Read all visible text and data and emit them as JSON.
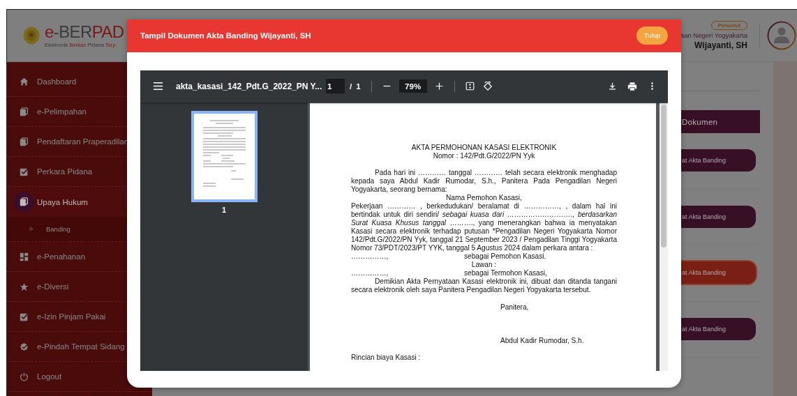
{
  "header": {
    "logo": {
      "title": [
        {
          "text": "e",
          "accent": true
        },
        {
          "text": "-BER",
          "accent": false
        },
        {
          "text": "PAD",
          "accent": true
        }
      ],
      "subtitle": [
        {
          "text": "Elektronik ",
          "accent": false
        },
        {
          "text": "Berkas",
          "accent": true
        },
        {
          "text": " Pidana ",
          "accent": false
        },
        {
          "text": "Terp",
          "accent": true
        }
      ]
    },
    "user": {
      "role": "Penuntut",
      "office": "aan Negeri Yogyakarta",
      "name": "Wijayanti, SH"
    }
  },
  "sidebar": {
    "items": [
      {
        "label": "Dashboard",
        "kind": "home",
        "selected": false
      },
      {
        "label": "e-Pelimpahan",
        "kind": "copy",
        "selected": false
      },
      {
        "label": "Pendaftaran Praperadilan",
        "kind": "copy",
        "selected": false
      },
      {
        "label": "Perkara Pidana",
        "kind": "check",
        "selected": false
      },
      {
        "label": "Upaya Hukum",
        "kind": "copy",
        "selected": true,
        "children": [
          {
            "label": "Banding",
            "kind": "diamond",
            "selected": false
          }
        ]
      },
      {
        "label": "e-Penahanan",
        "kind": "grid",
        "selected": false
      },
      {
        "label": "e-Diversi",
        "kind": "star",
        "selected": false
      },
      {
        "label": "e-Izin Pinjam Pakai",
        "kind": "check",
        "selected": false
      },
      {
        "label": "e-Pindah Tempat Sidang",
        "kind": "badge",
        "selected": false
      },
      {
        "label": "Logout",
        "kind": "power",
        "selected": false
      }
    ]
  },
  "content": {
    "column_header": "Dokumen",
    "buttons": [
      {
        "label": "at Akta Banding",
        "selected": false
      },
      {
        "label": "at Akta Banding",
        "selected": false
      },
      {
        "label": "at Akta Banding",
        "selected": true
      },
      {
        "label": "at Akta Banding",
        "selected": false
      }
    ]
  },
  "modal": {
    "title": "Tampil Dokumen Akta Banding Wijayanti, SH",
    "close_button": "Tutup",
    "viewer": {
      "filename": "akta_kasasi_142_Pdt.G_2022_PN Y...",
      "page": "1",
      "page_separator": "/",
      "total_pages": "1",
      "zoom": "79%",
      "thumbnails": [
        {
          "label": "1",
          "selected": true
        }
      ],
      "document": {
        "blocks": [
          {
            "kind": "title",
            "text": "AKTA PERMOHONAN KASASI ELEKTRONIK"
          },
          {
            "kind": "subtitle",
            "text": "Nomor : 142/Pdt.G/2022/PN Yyk"
          },
          {
            "kind": "paragraph",
            "indent": true,
            "segments": [
              {
                "text": "Pada hari ini …………    tanggal    …………    telah secara elektronik menghadap kepada saya Abdul Kadir Rumodar, S.h., Panitera Pada Pengadilan Negeri Yogyakarta,  seorang bernama:",
                "italic": false
              }
            ]
          },
          {
            "kind": "center",
            "text": "Nama Pemohon Kasasi,"
          },
          {
            "kind": "paragraph",
            "indent": false,
            "segments": [
              {
                "text": "Pekerjaan ………… , berkedudukan/ beralamat di ……………, , dalam hal ini bertindak untuk diri sendiri/ ",
                "italic": false
              },
              {
                "text": "sebagai kuasa dari ………………………., berdasarkan Surat Kuasa Khusus tanggal",
                "italic": true
              },
              {
                "text": " ………., yang menerangkan bahwa ia menyatakan Kasasi secara elektronik terhadap putusan *Pengadilan Negeri Yogyakarta Nomor 142/Pdt.G/2022/PN Yyk, tanggal 21 September 2023 / Pengadilan Tinggi Yogyakarta Nomor 73/PDT/2023/PT YYK, tanggal 5 Agustus 2024  dalam perkara antara :",
                "italic": false
              }
            ]
          },
          {
            "kind": "pair",
            "left": "……………,",
            "right": "sebagai Pemohon Kasasi."
          },
          {
            "kind": "center",
            "text": "Lawan :"
          },
          {
            "kind": "pair",
            "left": "……………,",
            "right": "sebagai Termohon Kasasi,"
          },
          {
            "kind": "paragraph",
            "indent": true,
            "segments": [
              {
                "text": "Demikian Akta Pernyataan Kasasi elektronik ini, dibuat dan ditanda tangani secara elektronik oleh saya Panitera Pengadilan Negeri Yogyakarta  tersebut.",
                "italic": false
              }
            ]
          },
          {
            "kind": "signature_role",
            "text": "Panitera,"
          },
          {
            "kind": "signature_name",
            "text": "Abdul Kadir Rumodar, S.h."
          },
          {
            "kind": "section",
            "text": "Rincian biaya Kasasi :"
          }
        ]
      }
    }
  }
}
